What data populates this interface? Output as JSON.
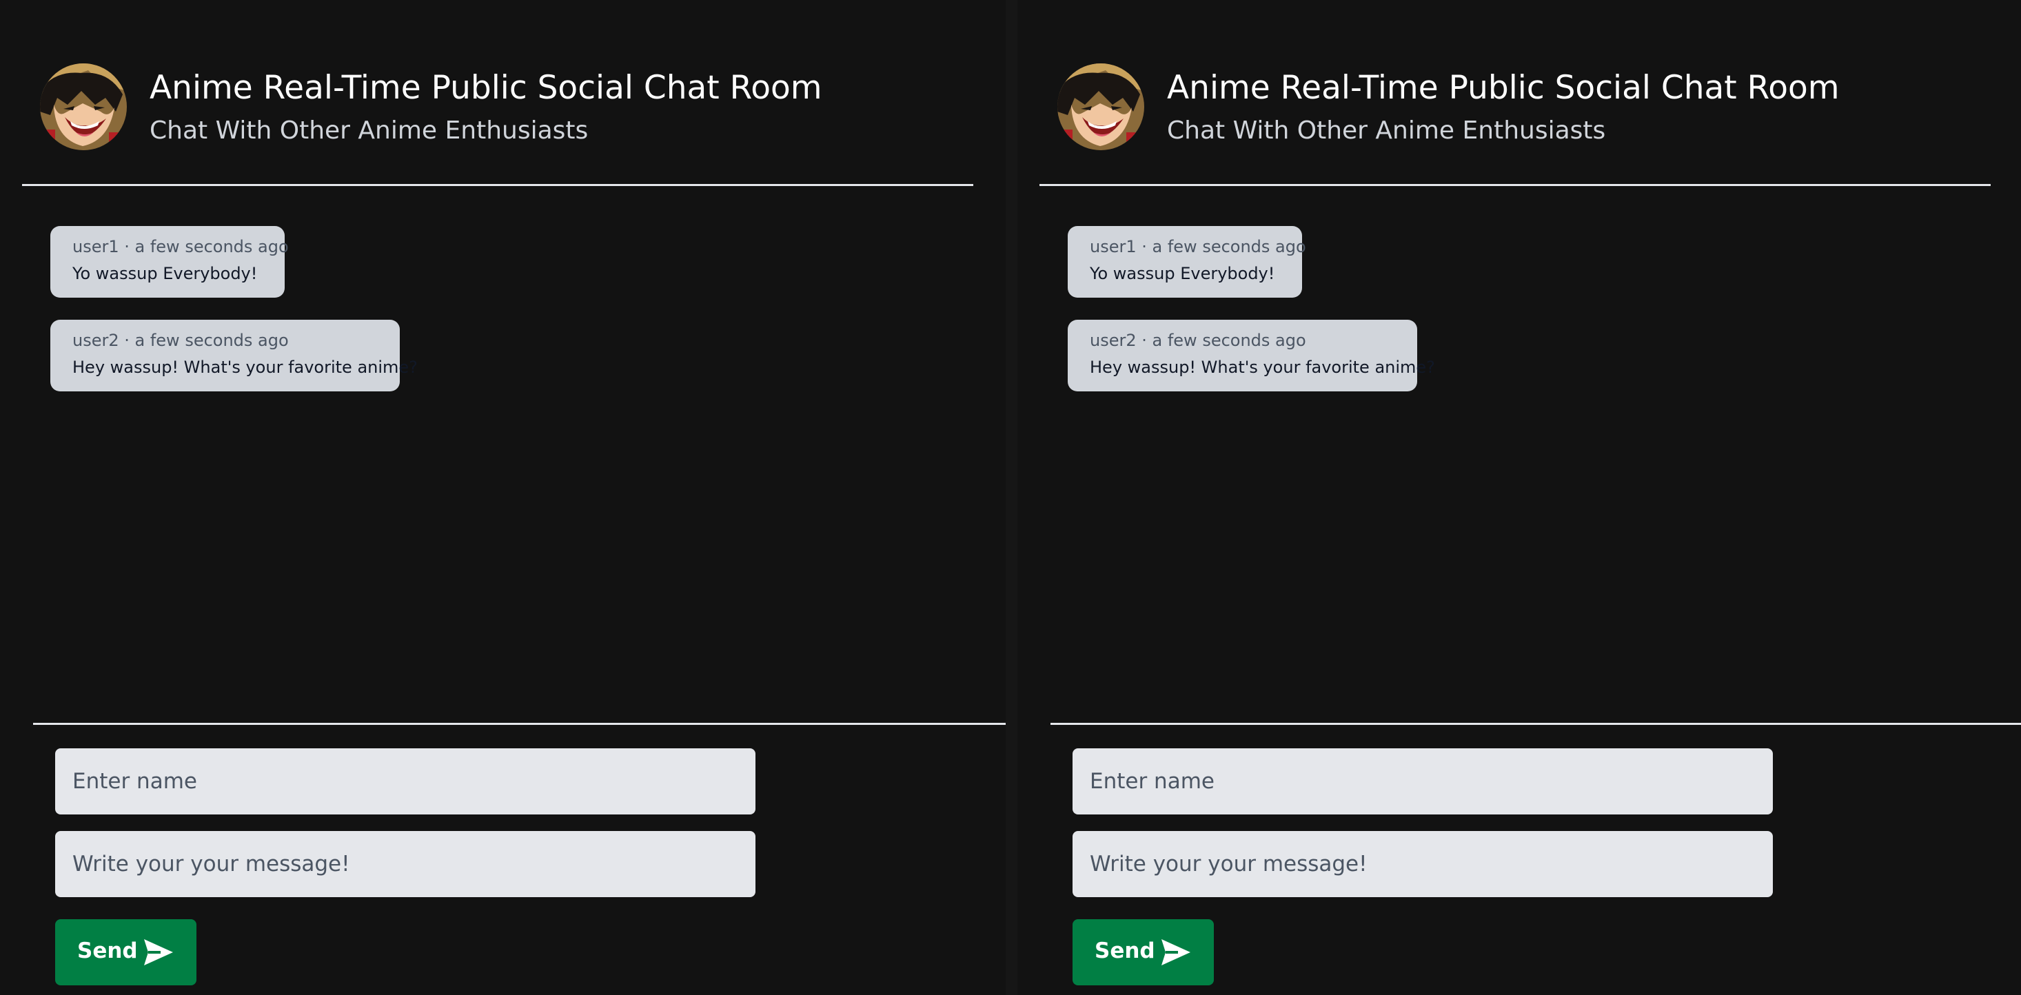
{
  "header": {
    "title": "Anime Real-Time Public Social Chat Room",
    "subtitle": "Chat With Other Anime Enthusiasts",
    "avatar_icon": "anime-character-avatar"
  },
  "messages": [
    {
      "meta": "user1 · a few seconds ago",
      "text": "Yo wassup Everybody!"
    },
    {
      "meta": "user2 · a few seconds ago",
      "text": "Hey wassup! What's your favorite anime?"
    }
  ],
  "form": {
    "name_placeholder": "Enter name",
    "message_placeholder": "Write your your message!",
    "send_label": "Send",
    "send_icon": "paper-plane-icon"
  },
  "colors": {
    "background": "#121212",
    "bubble": "#d1d5db",
    "input": "#e5e7eb",
    "send_button": "#017f44"
  }
}
